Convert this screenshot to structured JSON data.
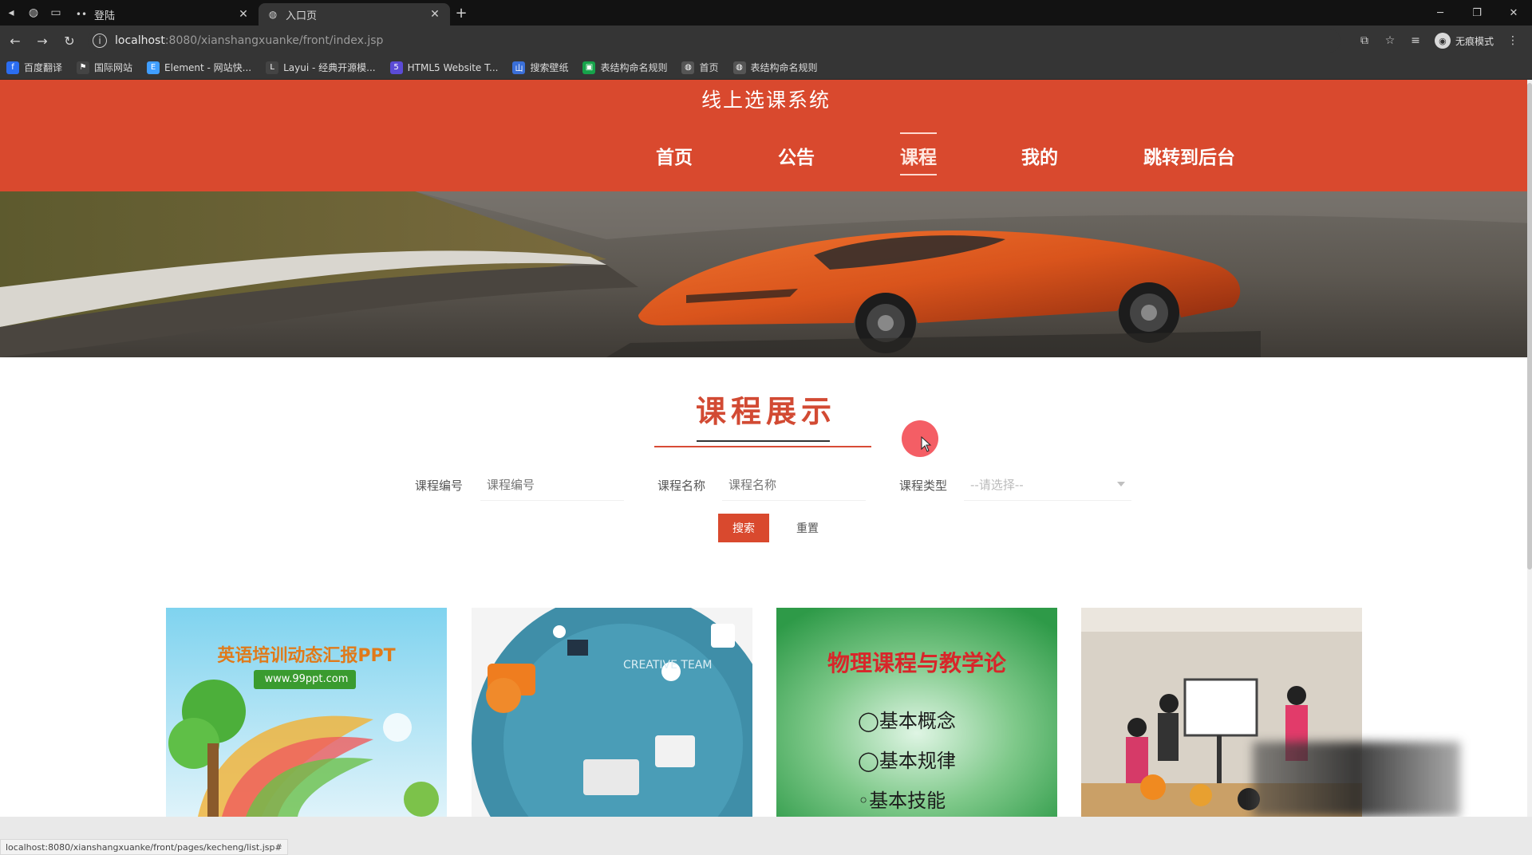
{
  "browser": {
    "tabs": [
      {
        "title": "登陆",
        "active": false
      },
      {
        "title": "入口页",
        "active": true
      }
    ],
    "url_host": "localhost",
    "url_rest": ":8080/xianshangxuanke/front/index.jsp",
    "profile_label": "无痕模式",
    "bookmarks": [
      {
        "label": "百度翻译",
        "icon": "baidu-translate-icon",
        "color": "#2b6df0"
      },
      {
        "label": "国际网站",
        "icon": "flag-icon",
        "color": "#444444"
      },
      {
        "label": "Element - 网站快...",
        "icon": "element-icon",
        "color": "#409eff"
      },
      {
        "label": "Layui - 经典开源模...",
        "icon": "layui-icon",
        "color": "#444444"
      },
      {
        "label": "HTML5 Website T...",
        "icon": "html5-icon",
        "color": "#5b4bd6"
      },
      {
        "label": "搜索壁纸",
        "icon": "wallpaper-icon",
        "color": "#3a6fd8"
      },
      {
        "label": "表结构命名规则",
        "icon": "green-doc-icon",
        "color": "#16a34a"
      },
      {
        "label": "首页",
        "icon": "globe-icon",
        "color": "#555555"
      },
      {
        "label": "表结构命名规则",
        "icon": "globe-icon",
        "color": "#555555"
      }
    ],
    "status_url": "localhost:8080/xianshangxuanke/front/pages/kecheng/list.jsp#"
  },
  "header": {
    "site_title": "线上选课系统",
    "nav": [
      {
        "label": "首页",
        "active": false
      },
      {
        "label": "公告",
        "active": false
      },
      {
        "label": "课程",
        "active": true
      },
      {
        "label": "我的",
        "active": false
      },
      {
        "label": "跳转到后台",
        "active": false
      }
    ],
    "accent_color": "#d9492e"
  },
  "banner": {
    "slides": 3,
    "active_slide": 1
  },
  "section": {
    "title": "课程展示"
  },
  "filters": {
    "course_no_label": "课程编号",
    "course_no_placeholder": "课程编号",
    "course_name_label": "课程名称",
    "course_name_placeholder": "课程名称",
    "course_type_label": "课程类型",
    "course_type_selected": "--请选择--",
    "search_label": "搜索",
    "reset_label": "重置"
  },
  "cards": [
    {
      "caption": "英语培训动态汇报PPT",
      "sub": "www.99ppt.com"
    },
    {
      "caption": "CREATIVE TEAM",
      "sub": ""
    },
    {
      "caption": "物理课程与教学论",
      "items": [
        "基本概念",
        "基本规律",
        "基本技能"
      ]
    },
    {
      "caption": "",
      "sub": ""
    }
  ]
}
